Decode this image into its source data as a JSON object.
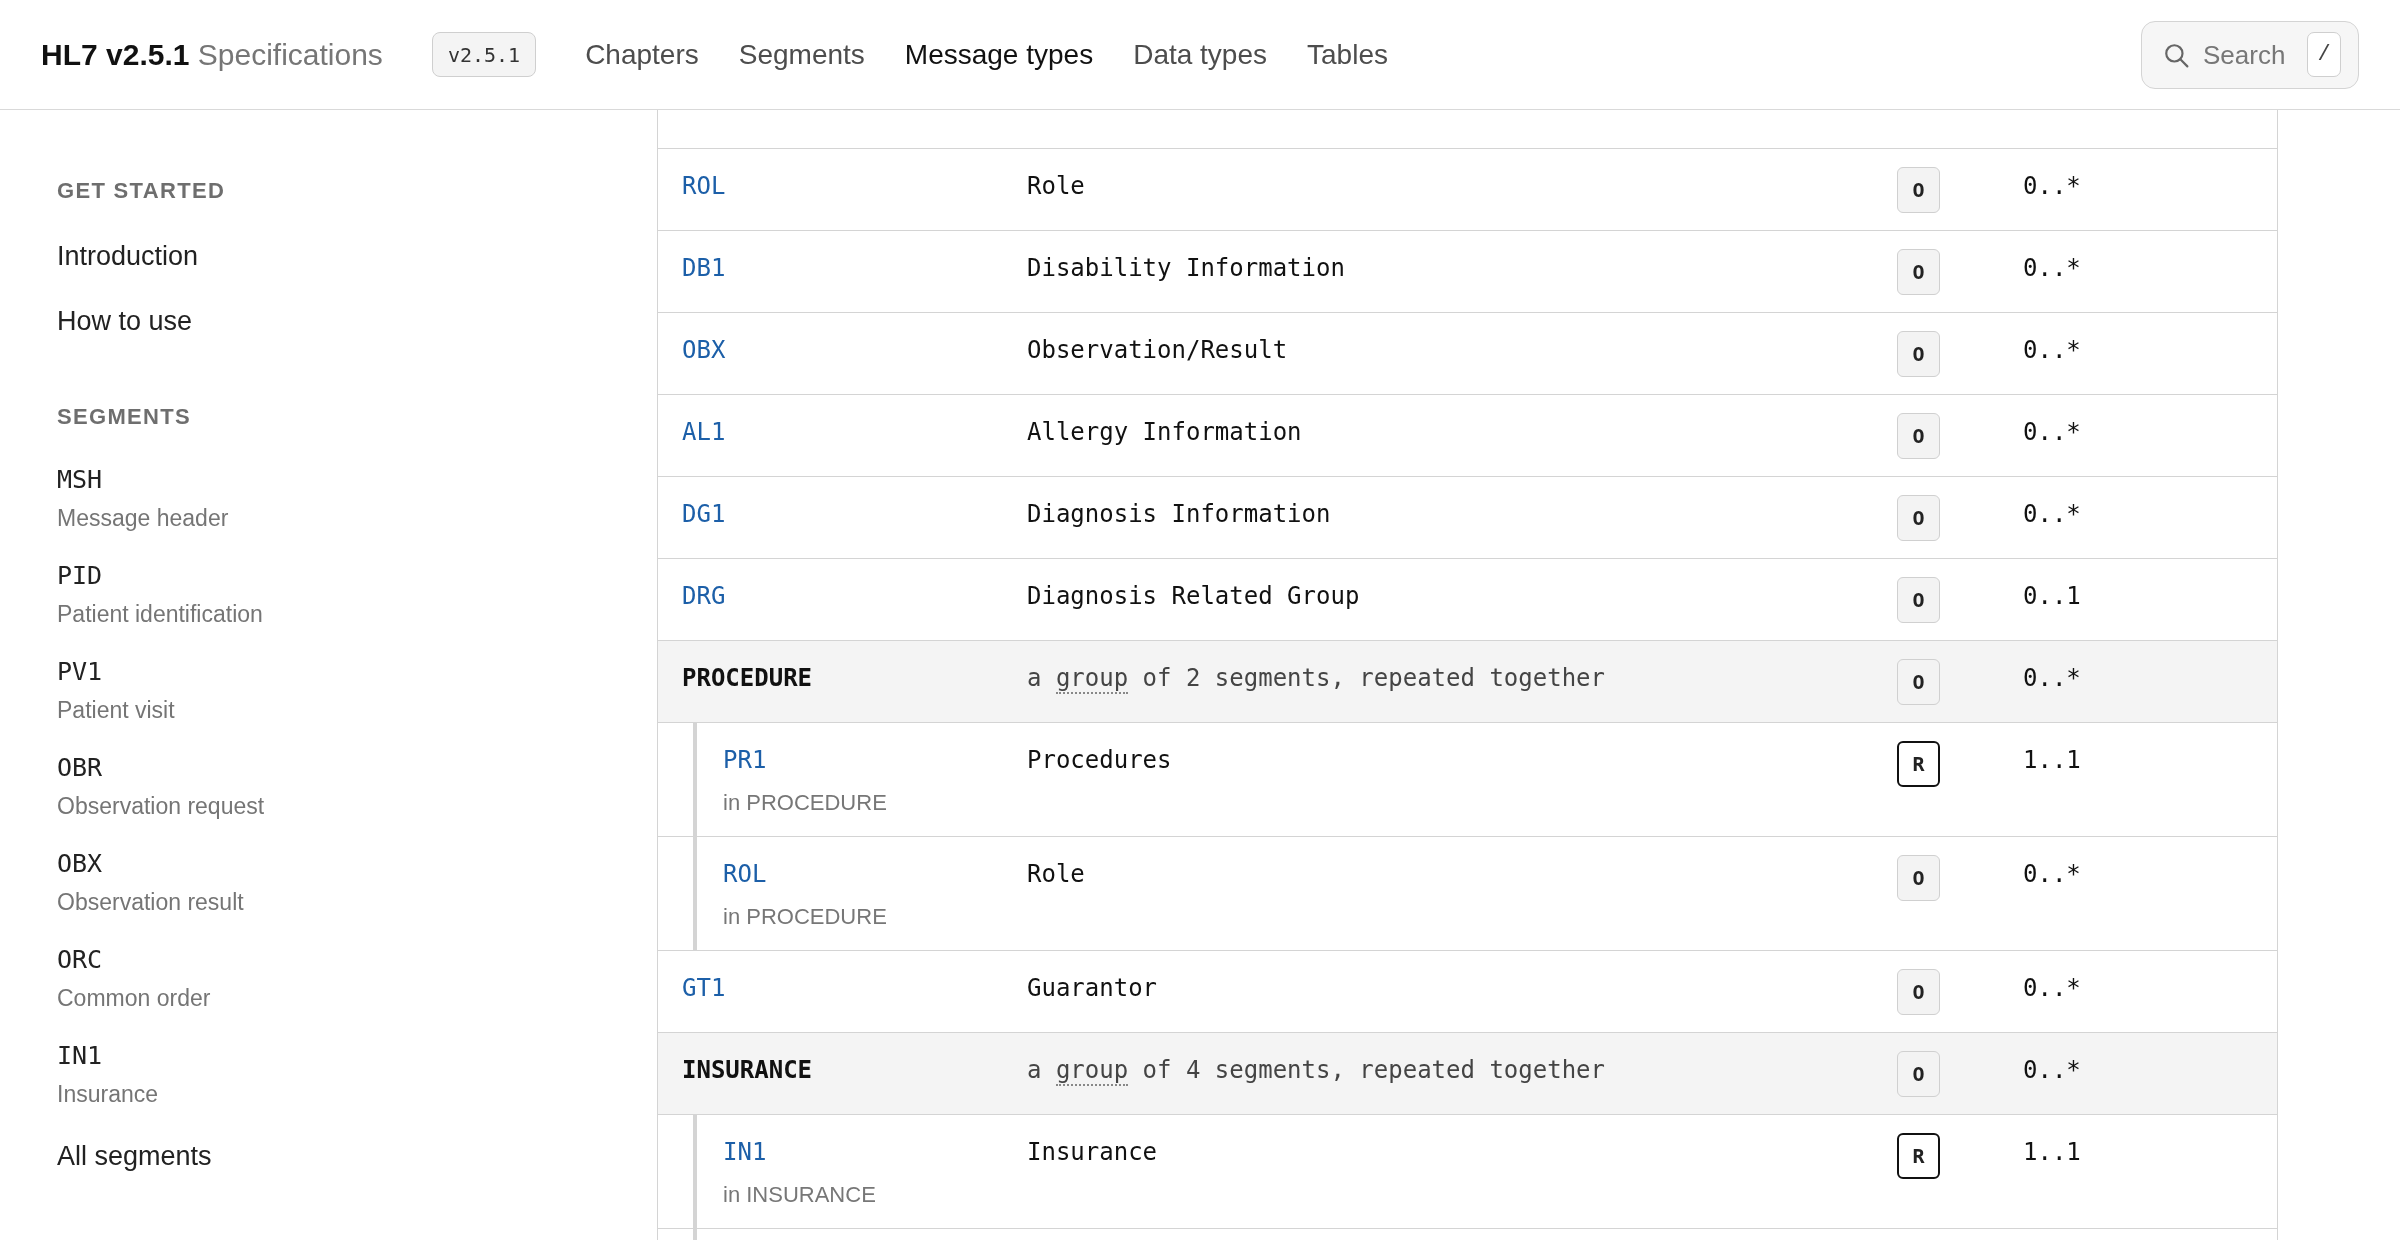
{
  "header": {
    "logo": {
      "title": "HL7 v2.5.1",
      "subtitle": "Specifications"
    },
    "version": "v2.5.1",
    "nav": [
      {
        "label": "Chapters",
        "selected": false
      },
      {
        "label": "Segments",
        "selected": false
      },
      {
        "label": "Message types",
        "selected": true
      },
      {
        "label": "Data types",
        "selected": false
      },
      {
        "label": "Tables",
        "selected": false
      }
    ],
    "search": {
      "label": "Search",
      "shortcut": "/"
    }
  },
  "sidebar": {
    "sections": [
      {
        "heading": "GET STARTED",
        "items": [
          {
            "kind": "page",
            "label": "Introduction"
          },
          {
            "kind": "page",
            "label": "How to use"
          }
        ]
      },
      {
        "heading": "SEGMENTS",
        "items": [
          {
            "kind": "segment",
            "code": "MSH",
            "label": "Message header"
          },
          {
            "kind": "segment",
            "code": "PID",
            "label": "Patient identification"
          },
          {
            "kind": "segment",
            "code": "PV1",
            "label": "Patient visit"
          },
          {
            "kind": "segment",
            "code": "OBR",
            "label": "Observation request"
          },
          {
            "kind": "segment",
            "code": "OBX",
            "label": "Observation result"
          },
          {
            "kind": "segment",
            "code": "ORC",
            "label": "Common order"
          },
          {
            "kind": "segment",
            "code": "IN1",
            "label": "Insurance"
          },
          {
            "kind": "page",
            "label": "All segments"
          }
        ]
      }
    ]
  },
  "table": {
    "rows": [
      {
        "kind": "segment",
        "name": "ROL",
        "description": "Role",
        "optionality": "O",
        "required": false,
        "cardinality": "0..*"
      },
      {
        "kind": "segment",
        "name": "DB1",
        "description": "Disability Information",
        "optionality": "O",
        "required": false,
        "cardinality": "0..*"
      },
      {
        "kind": "segment",
        "name": "OBX",
        "description": "Observation/Result",
        "optionality": "O",
        "required": false,
        "cardinality": "0..*"
      },
      {
        "kind": "segment",
        "name": "AL1",
        "description": "Allergy Information",
        "optionality": "O",
        "required": false,
        "cardinality": "0..*"
      },
      {
        "kind": "segment",
        "name": "DG1",
        "description": "Diagnosis Information",
        "optionality": "O",
        "required": false,
        "cardinality": "0..*"
      },
      {
        "kind": "segment",
        "name": "DRG",
        "description": "Diagnosis Related Group",
        "optionality": "O",
        "required": false,
        "cardinality": "0..1"
      },
      {
        "kind": "group",
        "name": "PROCEDURE",
        "description": {
          "before": "a",
          "term": "group",
          "after": "of 2 segments, repeated together"
        },
        "optionality": "O",
        "required": false,
        "cardinality": "0..*",
        "children": [
          {
            "kind": "segment",
            "name": "PR1",
            "note": "in PROCEDURE",
            "description": "Procedures",
            "optionality": "R",
            "required": true,
            "cardinality": "1..1"
          },
          {
            "kind": "segment",
            "name": "ROL",
            "note": "in PROCEDURE",
            "description": "Role",
            "optionality": "O",
            "required": false,
            "cardinality": "0..*"
          }
        ]
      },
      {
        "kind": "segment",
        "name": "GT1",
        "description": "Guarantor",
        "optionality": "O",
        "required": false,
        "cardinality": "0..*"
      },
      {
        "kind": "group",
        "name": "INSURANCE",
        "description": {
          "before": "a",
          "term": "group",
          "after": "of 4 segments, repeated together"
        },
        "optionality": "O",
        "required": false,
        "cardinality": "0..*",
        "children": [
          {
            "kind": "segment",
            "name": "IN1",
            "note": "in INSURANCE",
            "description": "Insurance",
            "optionality": "R",
            "required": true,
            "cardinality": "1..1"
          }
        ]
      }
    ]
  }
}
